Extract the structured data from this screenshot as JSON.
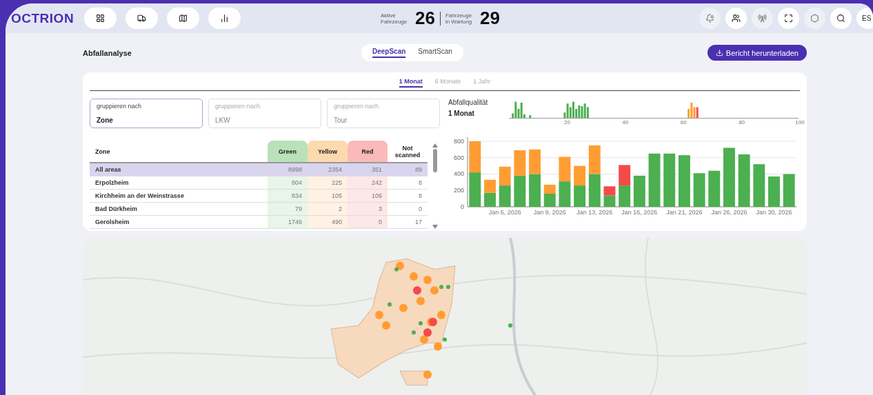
{
  "header": {
    "logo": "OCTRION",
    "stats": [
      {
        "label": "Aktive Fahrzeuge",
        "value": "26"
      },
      {
        "label": "Fahrzeuge in Wartung",
        "value": "29"
      }
    ],
    "actions": [
      {
        "active": false
      },
      {
        "active": true
      },
      {
        "active": false
      },
      {
        "active": true
      },
      {
        "active": false
      },
      {
        "active": true
      }
    ],
    "language": "ES"
  },
  "page": {
    "title": "Abfallanalyse",
    "modes": [
      {
        "label": "DeepScan",
        "selected": true
      },
      {
        "label": "SmartScan",
        "selected": false
      }
    ],
    "download_button": "Bericht herunterladen"
  },
  "periods": [
    {
      "label": "1 Monat",
      "selected": true
    },
    {
      "label": "6 Monate",
      "selected": false
    },
    {
      "label": "1 Jahr",
      "selected": false
    }
  ],
  "group_fields": [
    {
      "label": "gruppieren nach",
      "value": "Zone",
      "active": true
    },
    {
      "label": "gruppieren nach",
      "placeholder": "LKW",
      "active": false
    },
    {
      "label": "gruppieren nach",
      "placeholder": "Tour",
      "active": false
    }
  ],
  "quality": {
    "title": "Abfallqualität",
    "subtitle": "1 Monat",
    "axis_labels": [
      "20",
      "40",
      "60",
      "80",
      "100"
    ]
  },
  "table": {
    "columns": [
      {
        "label": "Zone",
        "kind": "name"
      },
      {
        "label": "Green",
        "kind": "green"
      },
      {
        "label": "Yellow",
        "kind": "yellow"
      },
      {
        "label": "Red",
        "kind": "red"
      },
      {
        "label": "Not scanned",
        "kind": "plain"
      }
    ],
    "rows": [
      {
        "cells": [
          "All areas",
          "8998",
          "2354",
          "351",
          "89"
        ],
        "selected": true
      },
      {
        "cells": [
          "Erpolzheim",
          "804",
          "225",
          "242",
          "8"
        ],
        "selected": false
      },
      {
        "cells": [
          "Kirchheim an der Weinstrasse",
          "834",
          "105",
          "106",
          "8"
        ],
        "selected": false
      },
      {
        "cells": [
          "Bad Dürkheim",
          "79",
          "2",
          "3",
          "0"
        ],
        "selected": false
      },
      {
        "cells": [
          "Gerolsheim",
          "1746",
          "490",
          "0",
          "17"
        ],
        "selected": false
      }
    ]
  },
  "chart_data": {
    "type": "bar",
    "stacked": true,
    "grid": true,
    "categories": [
      null,
      null,
      "Jan 6, 2026",
      null,
      null,
      "Jan 9, 2026",
      null,
      null,
      "Jan 13, 2026",
      null,
      null,
      "Jan 16, 2026",
      null,
      null,
      "Jan 21, 2026",
      null,
      null,
      "Jan 26, 2026",
      null,
      null,
      "Jan 30, 2026",
      null
    ],
    "yticks": [
      0,
      200,
      400,
      600,
      800
    ],
    "ylim": [
      0,
      850
    ],
    "series": [
      {
        "color": "#4caf50",
        "values": [
          420,
          170,
          260,
          380,
          400,
          160,
          310,
          260,
          400,
          140,
          260,
          380,
          650,
          650,
          630,
          410,
          440,
          720,
          640,
          520,
          370,
          400
        ]
      },
      {
        "color": "#ff9d33",
        "values": [
          380,
          160,
          230,
          310,
          300,
          110,
          300,
          240,
          350,
          null,
          null,
          null,
          null,
          null,
          null,
          null,
          null,
          null,
          null,
          null,
          null,
          null
        ]
      },
      {
        "color": "#f44a4a",
        "values": [
          null,
          null,
          null,
          null,
          null,
          null,
          null,
          null,
          null,
          110,
          250,
          null,
          null,
          null,
          null,
          null,
          null,
          null,
          null,
          null,
          null,
          null
        ]
      }
    ]
  }
}
